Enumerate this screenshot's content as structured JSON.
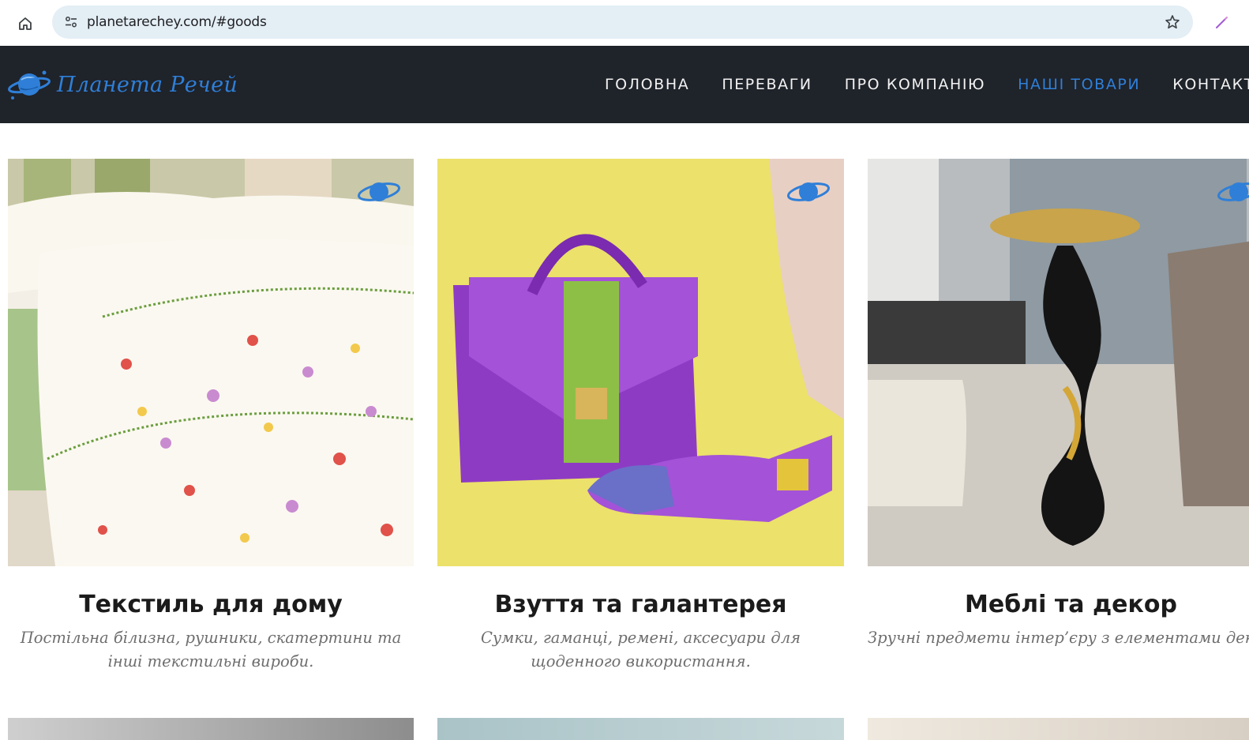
{
  "browser": {
    "url": "planetarechey.com/#goods"
  },
  "site": {
    "logo_text": "Планета Речей",
    "nav": [
      {
        "label": "ГОЛОВНА",
        "active": false
      },
      {
        "label": "ПЕРЕВАГИ",
        "active": false
      },
      {
        "label": "ПРО КОМПАНІЮ",
        "active": false
      },
      {
        "label": "НАШІ ТОВАРИ",
        "active": true
      },
      {
        "label": "КОНТАКТИ",
        "active": false
      }
    ],
    "accent_color": "#2f7fd8",
    "header_bg": "#1f232a"
  },
  "goods": [
    {
      "title": "Текстиль для дому",
      "description": "Постільна білизна, рушники, скатертини та інші текстильні вироби.",
      "image": "floral-bedding-photo"
    },
    {
      "title": "Взуття та галантерея",
      "description": "Сумки, гаманці, ремені, аксесуари для щоденного використання.",
      "image": "purple-handbag-and-shoe-photo"
    },
    {
      "title": "Меблі та декор",
      "description": "Зручні предмети інтер’єру з елементами декору.",
      "image": "gold-black-side-table-photo"
    }
  ]
}
